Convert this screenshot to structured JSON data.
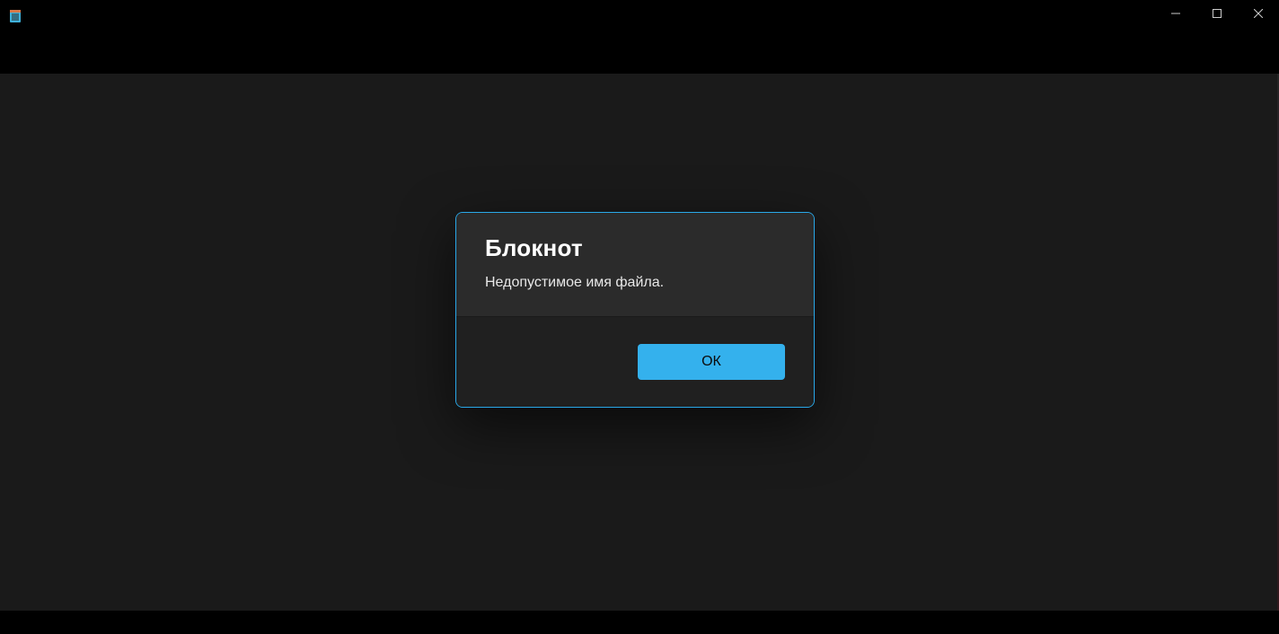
{
  "titlebar": {
    "app_icon": "notepad-icon"
  },
  "dialog": {
    "title": "Блокнот",
    "message": "Недопустимое имя файла.",
    "ok_label": "ОК"
  }
}
